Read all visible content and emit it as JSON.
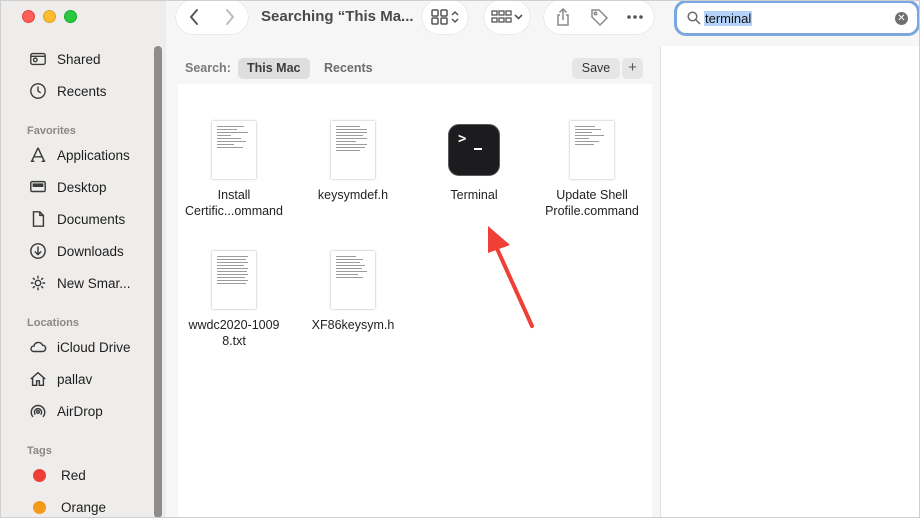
{
  "window": {
    "title": "Searching “This Ma..."
  },
  "search": {
    "query": "terminal"
  },
  "sidebar": {
    "items_top": [
      {
        "label": "Shared",
        "icon": "shared-folder-icon"
      },
      {
        "label": "Recents",
        "icon": "clock-icon"
      }
    ],
    "favorites_header": "Favorites",
    "favorites": [
      {
        "label": "Applications",
        "icon": "applications-icon"
      },
      {
        "label": "Desktop",
        "icon": "desktop-icon"
      },
      {
        "label": "Documents",
        "icon": "document-icon"
      },
      {
        "label": "Downloads",
        "icon": "download-icon"
      },
      {
        "label": "New Smar...",
        "icon": "gear-icon"
      }
    ],
    "locations_header": "Locations",
    "locations": [
      {
        "label": "iCloud Drive",
        "icon": "cloud-icon"
      },
      {
        "label": "pallav",
        "icon": "home-icon"
      },
      {
        "label": "AirDrop",
        "icon": "airdrop-icon"
      }
    ],
    "tags_header": "Tags",
    "tags": [
      {
        "label": "Red",
        "color": "#ee3f36"
      },
      {
        "label": "Orange",
        "color": "#f29a1a"
      }
    ]
  },
  "scope": {
    "label": "Search:",
    "options": [
      "This Mac",
      "Recents"
    ],
    "selected": "This Mac",
    "save_label": "Save",
    "add_label": "+"
  },
  "files": [
    {
      "name_line1": "Install",
      "name_line2": "Certific...ommand",
      "kind": "document"
    },
    {
      "name_line1": "keysymdef.h",
      "name_line2": "",
      "kind": "document"
    },
    {
      "name_line1": "Terminal",
      "name_line2": "",
      "kind": "app"
    },
    {
      "name_line1": "Update Shell",
      "name_line2": "Profile.command",
      "kind": "document"
    },
    {
      "name_line1": "wwdc2020-1009",
      "name_line2": "8.txt",
      "kind": "document"
    },
    {
      "name_line1": "XF86keysym.h",
      "name_line2": "",
      "kind": "document"
    }
  ],
  "colors": {
    "accent_arrow": "#ee4036",
    "search_focus": "#7aa7df"
  }
}
